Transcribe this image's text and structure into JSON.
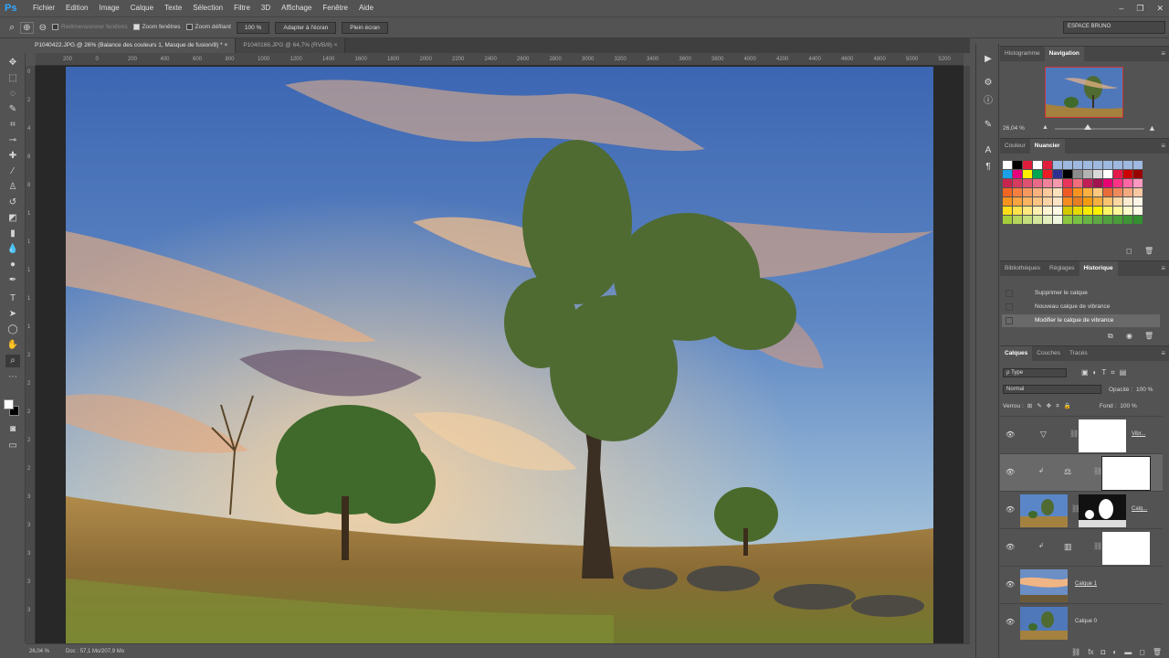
{
  "app": {
    "logo": "Ps"
  },
  "menu": [
    "Fichier",
    "Edition",
    "Image",
    "Calque",
    "Texte",
    "Sélection",
    "Filtre",
    "3D",
    "Affichage",
    "Fenêtre",
    "Aide"
  ],
  "window_controls": [
    "–",
    "❐",
    "✕"
  ],
  "options": {
    "resize_windows": "Redimensionner fenêtres",
    "zoom_windows": "Zoom fenêtres",
    "scroll_zoom": "Zoom défilant",
    "zoom_value": "100 %",
    "fit_screen": "Adapter à l'écran",
    "full_screen": "Plein écran",
    "workspace": "ESPACE BRUNO"
  },
  "tabs": [
    {
      "label": "P1040422.JPG @ 26% (Balance des couleurs 1, Masque de fusion/8) *",
      "close": "×"
    },
    {
      "label": "P1040166.JPG @ 64,7% (RVB/8)",
      "close": "×"
    }
  ],
  "ruler_top": [
    "200",
    "0",
    "200",
    "400",
    "600",
    "800",
    "1000",
    "1200",
    "1400",
    "1600",
    "1800",
    "2000",
    "2200",
    "2400",
    "2600",
    "2800",
    "3000",
    "3200",
    "3400",
    "3600",
    "3800",
    "4000",
    "4200",
    "4400",
    "4600",
    "4800",
    "5000",
    "5200",
    "5400",
    "56"
  ],
  "ruler_left": [
    "0",
    "2",
    "4",
    "6",
    "8",
    "1",
    "1",
    "1",
    "1",
    "1",
    "2",
    "2",
    "2",
    "2",
    "2",
    "3",
    "3",
    "3",
    "3",
    "3"
  ],
  "status": {
    "zoom": "26,04 %",
    "doc": "Doc : 57,1 Mo/207,9 Mo"
  },
  "nav": {
    "tabs": [
      "Histogramme",
      "Navigation"
    ],
    "zoom": "26,04 %"
  },
  "swatch_panel": {
    "tabs": [
      "Couleur",
      "Nuancier"
    ]
  },
  "history": {
    "tabs": [
      "Bibliothèques",
      "Réglages",
      "Historique"
    ],
    "items": [
      "Supprimer le calque",
      "Nouveau calque de vibrance",
      "Modifier le calque de vibrance"
    ]
  },
  "layers": {
    "tabs": [
      "Calques",
      "Couches",
      "Tracés"
    ],
    "filter": "ρ Type",
    "blend": "Normal",
    "opacity_label": "Opacité :",
    "opacity": "100 %",
    "lock_label": "Verrou :",
    "fill_label": "Fond :",
    "fill": "100 %",
    "items": [
      {
        "name": "Vibr...",
        "type": "▽"
      },
      {
        "name": "",
        "type": "⚖"
      },
      {
        "name": "Calq...",
        "type": ""
      },
      {
        "name": "",
        "type": "▥"
      },
      {
        "name": "Calque 1",
        "type": ""
      },
      {
        "name": "Calque 0",
        "type": ""
      }
    ]
  },
  "colors": {
    "accent": "#31a8ff",
    "panel": "#535353",
    "dark": "#282828"
  }
}
